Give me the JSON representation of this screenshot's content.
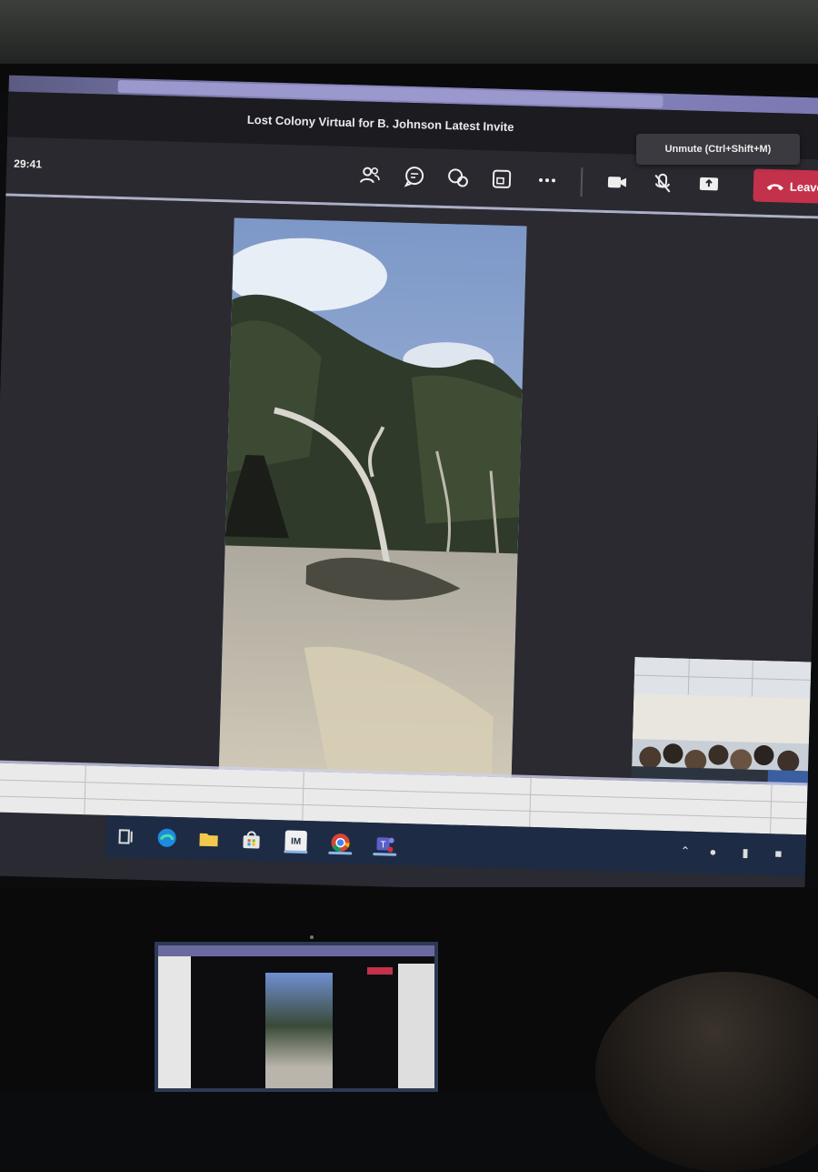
{
  "window": {
    "title": "Lost Colony Virtual for B. Johnson Latest Invite",
    "minimize_glyph": "—"
  },
  "toolbar": {
    "timer": "29:41",
    "buttons": [
      {
        "icon": "people-icon"
      },
      {
        "icon": "chat-icon"
      },
      {
        "icon": "reactions-icon"
      },
      {
        "icon": "rooms-icon"
      },
      {
        "icon": "more-icon"
      },
      {
        "icon": "camera-icon"
      },
      {
        "icon": "microphone-muted-icon"
      },
      {
        "icon": "share-screen-icon"
      }
    ],
    "leave_label": "Leave",
    "leave_color": "#c4314b"
  },
  "tooltip": {
    "text": "Unmute (Ctrl+Shift+M)"
  },
  "taskbar": {
    "apps": [
      {
        "icon": "task-view-icon"
      },
      {
        "icon": "edge-icon"
      },
      {
        "icon": "file-explorer-icon"
      },
      {
        "icon": "store-icon"
      },
      {
        "icon": "app-im-icon",
        "label": "IM"
      },
      {
        "icon": "chrome-icon"
      },
      {
        "icon": "teams-icon"
      }
    ],
    "tray": [
      "chevron-up-icon",
      "notification-icon",
      "mic-icon",
      "folder-icon"
    ]
  },
  "colors": {
    "accent": "#8a88c0",
    "stage_bg": "#2a2a30",
    "taskbar_bg": "#1d2c44"
  }
}
